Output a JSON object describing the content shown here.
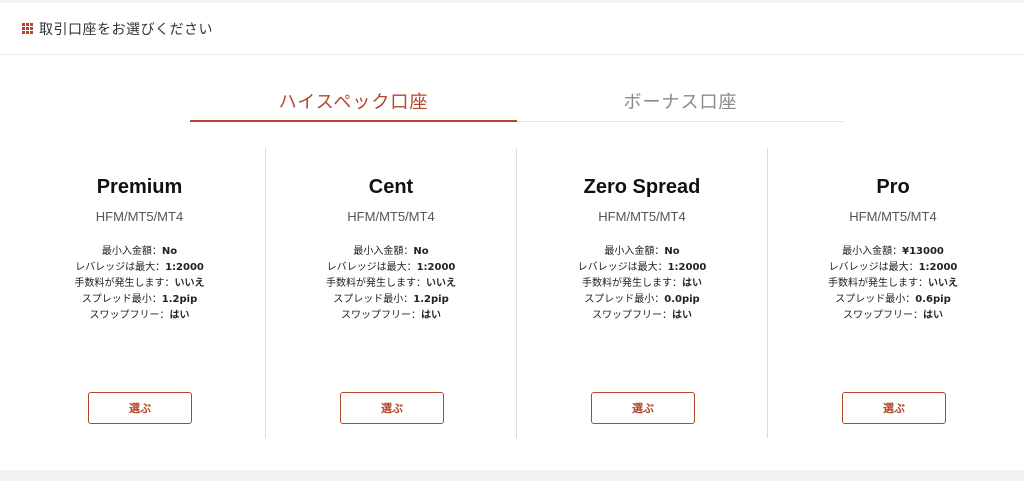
{
  "header": {
    "icon": "grid-icon",
    "title": "取引口座をお選びください"
  },
  "tabs": [
    {
      "label": "ハイスペック口座",
      "active": true
    },
    {
      "label": "ボーナス口座",
      "active": false
    }
  ],
  "colors": {
    "accent": "#b3472b"
  },
  "cards": [
    {
      "name": "Premium",
      "platform": "HFM/MT5/MT4",
      "specs": [
        {
          "label": "最小入金額：",
          "value": "No"
        },
        {
          "label": "レバレッジは最大：",
          "value": "1:2000"
        },
        {
          "label": "手数料が発生します：",
          "value": "いいえ"
        },
        {
          "label": "スプレッド最小：",
          "value": "1.2pip"
        },
        {
          "label": "スワップフリー：",
          "value": "はい"
        }
      ],
      "button": "選ぶ"
    },
    {
      "name": "Cent",
      "platform": "HFM/MT5/MT4",
      "specs": [
        {
          "label": "最小入金額：",
          "value": "No"
        },
        {
          "label": "レバレッジは最大：",
          "value": "1:2000"
        },
        {
          "label": "手数料が発生します：",
          "value": "いいえ"
        },
        {
          "label": "スプレッド最小：",
          "value": "1.2pip"
        },
        {
          "label": "スワップフリー：",
          "value": "はい"
        }
      ],
      "button": "選ぶ"
    },
    {
      "name": "Zero Spread",
      "platform": "HFM/MT5/MT4",
      "specs": [
        {
          "label": "最小入金額：",
          "value": "No"
        },
        {
          "label": "レバレッジは最大：",
          "value": "1:2000"
        },
        {
          "label": "手数料が発生します：",
          "value": "はい"
        },
        {
          "label": "スプレッド最小：",
          "value": "0.0pip"
        },
        {
          "label": "スワップフリー：",
          "value": "はい"
        }
      ],
      "button": "選ぶ"
    },
    {
      "name": "Pro",
      "platform": "HFM/MT5/MT4",
      "specs": [
        {
          "label": "最小入金額：",
          "value": "¥13000"
        },
        {
          "label": "レバレッジは最大：",
          "value": "1:2000"
        },
        {
          "label": "手数料が発生します：",
          "value": "いいえ"
        },
        {
          "label": "スプレッド最小：",
          "value": "0.6pip"
        },
        {
          "label": "スワップフリー：",
          "value": "はい"
        }
      ],
      "button": "選ぶ"
    }
  ]
}
